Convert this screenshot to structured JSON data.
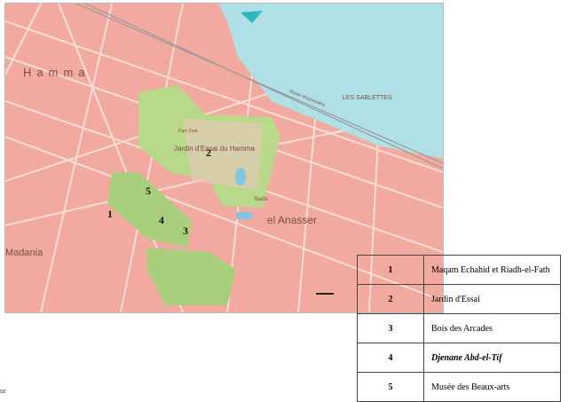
{
  "map": {
    "place_labels": [
      "Hamma",
      "LES SABLETTES",
      "Jardin d'Essai du Hamma",
      "el Anasser",
      "Madania",
      "Stade",
      "Route Moutonnière",
      "Parc Zool."
    ],
    "markers": [
      "1",
      "2",
      "3",
      "4",
      "5"
    ],
    "colors": {
      "urban": "#f2aaa0",
      "sea": "#aee0e6",
      "park": "#b8d98a",
      "road": "#fbe3df"
    }
  },
  "legend": [
    {
      "num": "1",
      "name": "Maqam Echahid et Riadh-el-Fath"
    },
    {
      "num": "2",
      "name": "Jardin d'Essai"
    },
    {
      "num": "3",
      "name": "Bois des Arcades"
    },
    {
      "num": "4",
      "name": "Djenane Abd-el-Tif"
    },
    {
      "num": "5",
      "name": "Musée des Beaux-arts"
    }
  ],
  "fragment": "ur"
}
